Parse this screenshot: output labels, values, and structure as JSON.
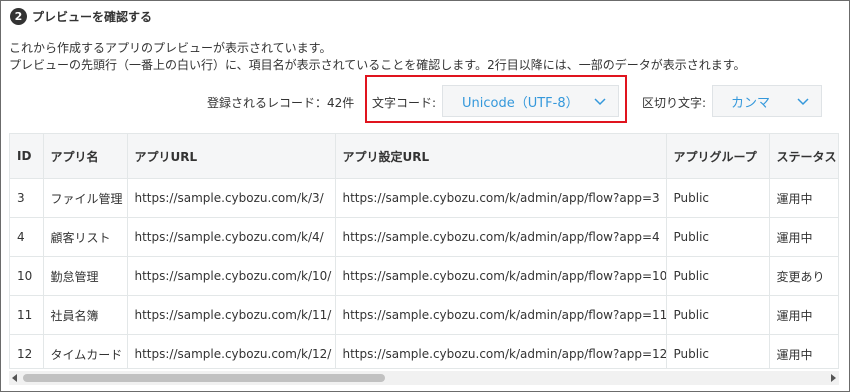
{
  "section": {
    "step": "2",
    "title": "プレビューを確認する"
  },
  "description": {
    "line1": "これから作成するアプリのプレビューが表示されています。",
    "line2": "プレビューの先頭行（一番上の白い行）に、項目名が表示されていることを確認します。2行目以降には、一部のデータが表示されます。"
  },
  "controls": {
    "record_count": "登録されるレコード：42件",
    "encoding_label": "文字コード:",
    "encoding_value": "Unicode（UTF-8）",
    "delimiter_label": "区切り文字:",
    "delimiter_value": "カンマ"
  },
  "table": {
    "headers": [
      "ID",
      "アプリ名",
      "アプリURL",
      "アプリ設定URL",
      "アプリグループ",
      "ステータス"
    ],
    "rows": [
      [
        "3",
        "ファイル管理",
        "https://sample.cybozu.com/k/3/",
        "https://sample.cybozu.com/k/admin/app/flow?app=3",
        "Public",
        "運用中"
      ],
      [
        "4",
        "顧客リスト",
        "https://sample.cybozu.com/k/4/",
        "https://sample.cybozu.com/k/admin/app/flow?app=4",
        "Public",
        "運用中"
      ],
      [
        "10",
        "勤怠管理",
        "https://sample.cybozu.com/k/10/",
        "https://sample.cybozu.com/k/admin/app/flow?app=10",
        "Public",
        "変更あり"
      ],
      [
        "11",
        "社員名簿",
        "https://sample.cybozu.com/k/11/",
        "https://sample.cybozu.com/k/admin/app/flow?app=11",
        "Public",
        "運用中"
      ],
      [
        "12",
        "タイムカード",
        "https://sample.cybozu.com/k/12/",
        "https://sample.cybozu.com/k/admin/app/flow?app=12",
        "Public",
        "運用中"
      ]
    ]
  },
  "colors": {
    "accent": "#3498db",
    "highlight": "#e0141e"
  },
  "icons": {
    "encoding_dropdown": "chevron-down-icon",
    "delimiter_dropdown": "chevron-down-icon"
  }
}
